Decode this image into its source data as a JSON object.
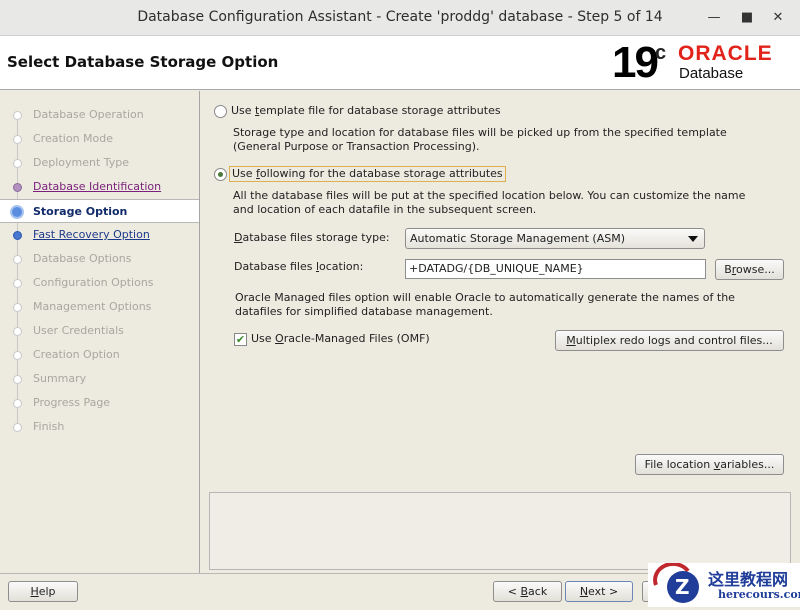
{
  "window": {
    "title": "Database Configuration Assistant - Create 'proddg' database - Step 5 of 14"
  },
  "header": {
    "title": "Select Database Storage Option",
    "logo_version": "19",
    "logo_sup": "c",
    "logo_brand": "ORACLE",
    "logo_product": "Database"
  },
  "steps": [
    {
      "label": "Database Operation",
      "state": "pending"
    },
    {
      "label": "Creation Mode",
      "state": "pending"
    },
    {
      "label": "Deployment Type",
      "state": "pending"
    },
    {
      "label": "Database Identification",
      "state": "done"
    },
    {
      "label": "Storage Option",
      "state": "current"
    },
    {
      "label": "Fast Recovery Option",
      "state": "next"
    },
    {
      "label": "Database Options",
      "state": "pending"
    },
    {
      "label": "Configuration Options",
      "state": "pending"
    },
    {
      "label": "Management Options",
      "state": "pending"
    },
    {
      "label": "User Credentials",
      "state": "pending"
    },
    {
      "label": "Creation Option",
      "state": "pending"
    },
    {
      "label": "Summary",
      "state": "pending"
    },
    {
      "label": "Progress Page",
      "state": "pending"
    },
    {
      "label": "Finish",
      "state": "pending"
    }
  ],
  "main": {
    "opt_template": {
      "pre": "Use ",
      "key": "t",
      "post": "emplate file for database storage attributes",
      "selected": false
    },
    "opt_template_desc1": "Storage type and location for database files will be picked up from the specified template",
    "opt_template_desc2": "(General Purpose or Transaction Processing).",
    "opt_following": {
      "pre": "Use ",
      "key": "f",
      "post": "ollowing for the database storage attributes",
      "selected": true
    },
    "opt_following_desc1": "All the database files will be put at the specified location below. You can customize the name",
    "opt_following_desc2": "and location of each datafile in the subsequent screen.",
    "storage_type_label": {
      "key": "D",
      "post": "atabase files storage type:"
    },
    "storage_type_value": "Automatic Storage Management (ASM)",
    "location_label": {
      "pre": "Database files ",
      "key": "l",
      "post": "ocation:"
    },
    "location_value": "+DATADG/{DB_UNIQUE_NAME}",
    "browse": {
      "pre": "B",
      "key": "r",
      "post": "owse..."
    },
    "omf_desc1": "Oracle Managed files option will enable Oracle to automatically generate the names of the",
    "omf_desc2": "datafiles for simplified database management.",
    "omf_check": {
      "pre": "Use ",
      "key": "O",
      "post": "racle-Managed Files (OMF)",
      "checked": true
    },
    "multiplex": {
      "key": "M",
      "post": "ultiplex redo logs and control files..."
    },
    "file_loc_vars": {
      "pre": "File location ",
      "key": "v",
      "post": "ariables..."
    }
  },
  "footer": {
    "help": {
      "key": "H",
      "post": "elp"
    },
    "back": {
      "pre": "< ",
      "key": "B",
      "post": "ack"
    },
    "next": {
      "key": "N",
      "post": "ext >"
    }
  },
  "watermark": {
    "text": "这里教程网",
    "url": "herecours.com"
  }
}
